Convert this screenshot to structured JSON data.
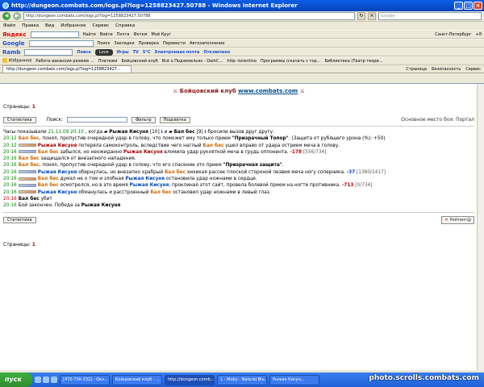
{
  "browser": {
    "title": "http://dungeon.combats.com/logs.pl?log=1258823427.50788 - Windows Internet Explorer",
    "address": "http://dungeon.combats.com/logs.pl?log=1258823427.50788",
    "search_placeholder": "Google",
    "menu": [
      "Файл",
      "Правка",
      "Вид",
      "Избранное",
      "Сервис",
      "Справка"
    ]
  },
  "toolbars": {
    "yandex": [
      "Яндекс",
      "Найти",
      "Войти",
      "Почта",
      "Фоткм",
      "Мой Круг",
      "Санкт-Петербург",
      "+8"
    ],
    "google": [
      "Google",
      "Поиск",
      "Закладки",
      "Проверка",
      "Перевести",
      "Автозаполнение"
    ],
    "rambler": [
      "Поиск",
      "Love",
      "Игры",
      "TV",
      "5°C",
      "Электронная почта",
      "Отключено"
    ],
    "favorites": [
      "Избранное",
      "Работа вакансии резюме ...",
      "Платежи",
      "Бойцовский клуб",
      "Всё о Подземельях - DarkC...",
      "http--torentino",
      "Программы (скачать с тор...",
      "Библиотека (Театр теори..."
    ]
  },
  "tabs": {
    "current": "http://dungeon.combats.com/logs.pl?log=1258823427...",
    "right": [
      "Страница",
      "Безопасность",
      "Сервис"
    ]
  },
  "page": {
    "title_prefix": "Бойцовский клуб",
    "title_url": "www.combats.com",
    "pages_label": "Страницы:",
    "page_num": "1",
    "stats_btn": "Статистика",
    "search_label": "Поиск:",
    "filter_btn": "Фильтр",
    "highlight_btn": "Подсветка",
    "location": "Основное место боя: Портал",
    "rating_btn": "Рейтинг@"
  },
  "log": {
    "intro": {
      "prefix": "Часы показывали",
      "date": "21.11.09 20:10",
      "comma": ", когда",
      "p1": "Рыжая Кисуня",
      "p1lvl": "[10]",
      "and": "и",
      "p2": "Бал бес",
      "p2lvl": "[9]",
      "rest": "бросили вызов друг другу."
    },
    "lines": [
      {
        "time": "20:12",
        "a": "Бал бес",
        "text": ", понял, пропустив очередной удар в голову, что поможет ему только прием ",
        "strong": "\"Призрачный Топор\"",
        "tail": ". (Защита от рубящего урона (%): +50)"
      },
      {
        "time": "20:12",
        "bar": "o",
        "a": "Рыжая Кисуня",
        "text": " потеряла самоконтроль, вследствие чего наглый ",
        "b": "Бал бес",
        "tail": " ушел вправо от удара острием меча в голову."
      },
      {
        "time": "20:16",
        "bar": "b",
        "a": "Бал бес",
        "text": " забылся, но неожиданно ",
        "b": "Рыжая Кисуня",
        "tail": " вломила удар рукояткой меча в грудь оппонента.",
        "dmg": "-178",
        "hp": "[556/734]"
      },
      {
        "time": "20:16",
        "a": "Бал бес",
        "text": " защищался от внезапного нападения.",
        "tail": ""
      },
      {
        "time": "20:16",
        "a": "Бал бес",
        "text": ", понял, пропустив очередной удар в голову, что его спасение это прием ",
        "strong": "\"Призрачная защита\"",
        "tail": "."
      },
      {
        "time": "20:16",
        "bar": "b",
        "a": "Рыжая Кисуня",
        "text": " обернулась, но внезапно храбрый ",
        "b": "Бал бес",
        "tail": " хихикая рассек плоской стороной лезвия меча ногу соперника.",
        "dmg": "-37",
        "hp": "[1380/1417]"
      },
      {
        "time": "20:16",
        "bar": "o",
        "a": "Бал бес",
        "text": " думал не о том и злобная ",
        "b": "Рыжая Кисуня",
        "tail": " остановила удар ножнами в сердце."
      },
      {
        "time": "20:16",
        "bar": "b",
        "a": "Бал бес",
        "text": " осмотрелся, но в это время ",
        "b": "Рыжая Кисуня",
        "tail": ", проклиная этот сайт, провела болевой прием на ногте противника.",
        "dmg": "-713",
        "hp": "[0/734]"
      },
      {
        "time": "20:16",
        "bar": "o",
        "a": "Рыжая Кисуня",
        "text": " обманулась и расстроенный ",
        "b": "Бал бес",
        "tail": " остановил удар ножнами в левый глаз."
      },
      {
        "time": "20:16",
        "red": true,
        "a": "Бал бес",
        "text": " убит",
        "tail": ""
      }
    ],
    "end": {
      "time": "20:16",
      "text": "Бой закончен. Победа за ",
      "winner": "Рыжая Кисуня"
    }
  },
  "taskbar": {
    "start": "пуск",
    "tasks": [
      "[470-756-332] - Окн...",
      "Бойцовский клуб - ...",
      "http://dungeon.comb...",
      "1 - Moby - Natural Blu...",
      "Рыжая Кисун..."
    ]
  },
  "watermark": "photo.scrolls.combats.com"
}
